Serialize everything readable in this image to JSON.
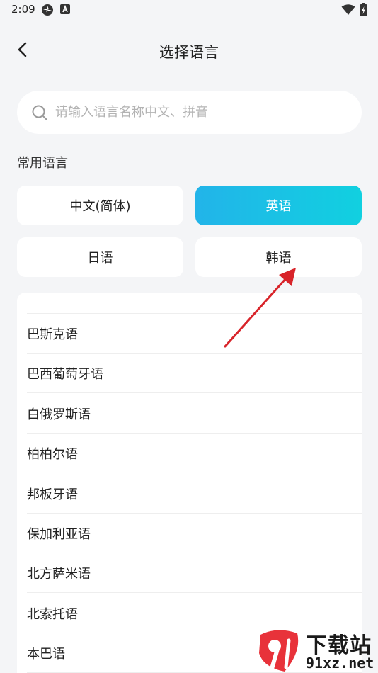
{
  "status_bar": {
    "time": "2:09"
  },
  "header": {
    "title": "选择语言"
  },
  "search": {
    "placeholder": "请输入语言名称中文、拼音"
  },
  "common": {
    "title": "常用语言",
    "items": [
      {
        "label": "中文(简体)",
        "active": false
      },
      {
        "label": "英语",
        "active": true
      },
      {
        "label": "日语",
        "active": false
      },
      {
        "label": "韩语",
        "active": false
      }
    ]
  },
  "languages": {
    "items": [
      "巴斯克语",
      "巴西葡萄牙语",
      "白俄罗斯语",
      "柏柏尔语",
      "邦板牙语",
      "保加利亚语",
      "北方萨米语",
      "北索托语",
      "本巴语"
    ]
  },
  "watermark": {
    "brand": "下载站",
    "url": "91xz.net"
  },
  "colors": {
    "accent_start": "#22b4e9",
    "accent_end": "#11d0e0",
    "annotation_arrow": "#d8242a"
  }
}
